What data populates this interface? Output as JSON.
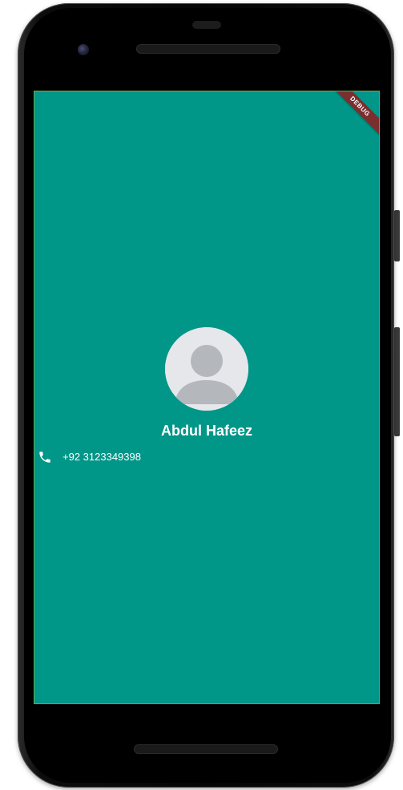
{
  "app": {
    "debug_banner": "DEBUG",
    "background_color": "#009688"
  },
  "contact": {
    "avatar_icon": "default-person-avatar-icon",
    "name": "Abdul Hafeez",
    "phone_icon": "phone-icon",
    "phone_number": "+92 3123349398"
  }
}
